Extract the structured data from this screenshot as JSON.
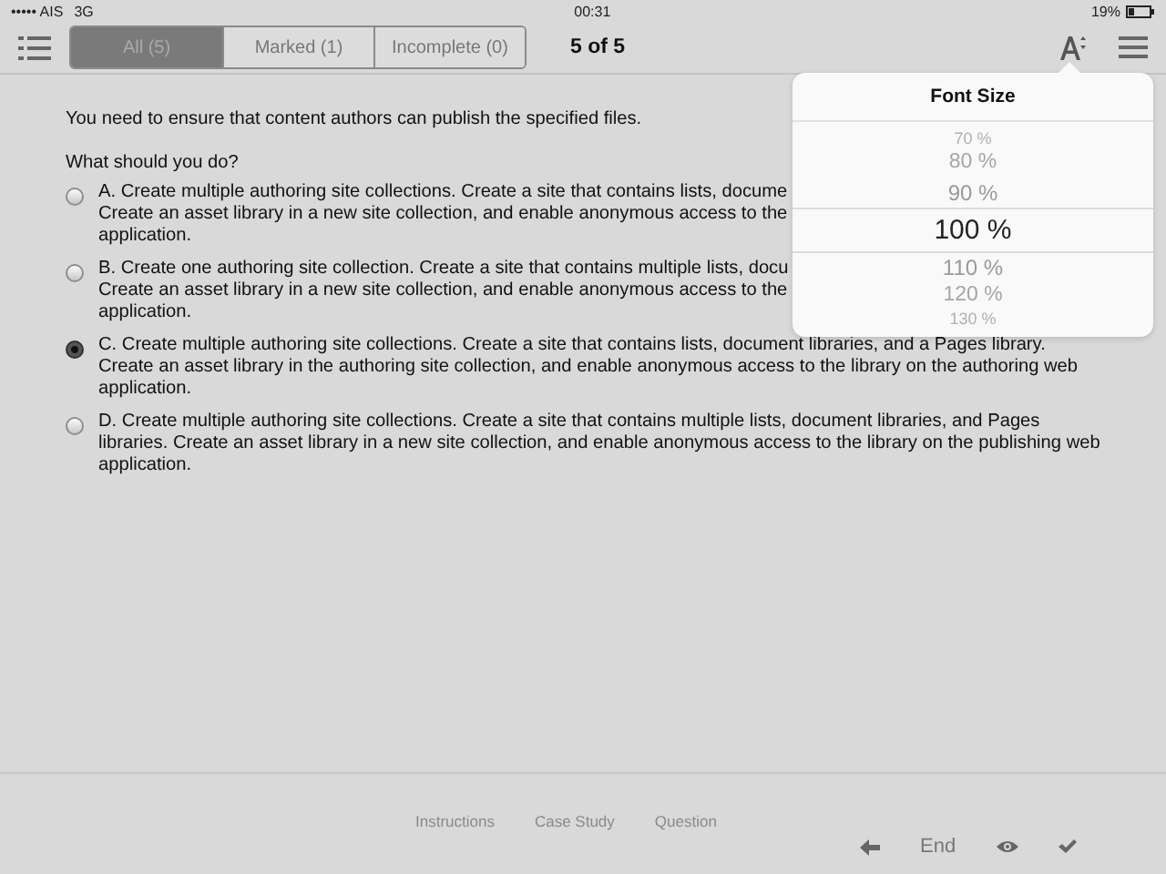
{
  "status_bar": {
    "carrier": "••••• AIS",
    "network": "3G",
    "time": "00:31",
    "battery": "19%"
  },
  "toolbar": {
    "filters": [
      {
        "label": "All (5)",
        "selected": true
      },
      {
        "label": "Marked (1)",
        "selected": false
      },
      {
        "label": "Incomplete (0)",
        "selected": false
      }
    ],
    "counter": "5 of 5"
  },
  "question": {
    "stem": "You need to ensure that content authors can publish the specified files.",
    "prompt": "What should you do?",
    "options": [
      {
        "lines": [
          "A. Create multiple authoring site collections. Create a site that contains lists, docume",
          "Create an asset library in a new site collection, and enable anonymous access to the",
          "application."
        ],
        "selected": false
      },
      {
        "lines": [
          "B. Create one authoring site collection. Create a site that contains multiple lists, docu",
          "Create an asset library in a new site collection, and enable anonymous access to the",
          "application."
        ],
        "selected": false
      },
      {
        "lines": [
          "C. Create multiple authoring site collections. Create a site that contains lists, document libraries, and a Pages library.",
          "Create an asset library in the authoring site collection, and enable anonymous access to the library on the authoring web",
          "application."
        ],
        "selected": true
      },
      {
        "lines": [
          "D. Create multiple authoring site collections. Create a site that contains multiple lists, document libraries, and Pages",
          "libraries. Create an asset library in a new site collection, and enable anonymous access to the library on the publishing web",
          "application."
        ],
        "selected": false
      }
    ]
  },
  "font_size_popover": {
    "title": "Font Size",
    "options": [
      {
        "label": "70 %",
        "selected": false
      },
      {
        "label": "80 %",
        "selected": false
      },
      {
        "label": "90 %",
        "selected": false
      },
      {
        "label": "100 %",
        "selected": true
      },
      {
        "label": "110 %",
        "selected": false
      },
      {
        "label": "120 %",
        "selected": false
      },
      {
        "label": "130 %",
        "selected": false
      }
    ]
  },
  "footer": {
    "tabs": [
      "Instructions",
      "Case Study",
      "Question"
    ],
    "end_label": "End"
  }
}
